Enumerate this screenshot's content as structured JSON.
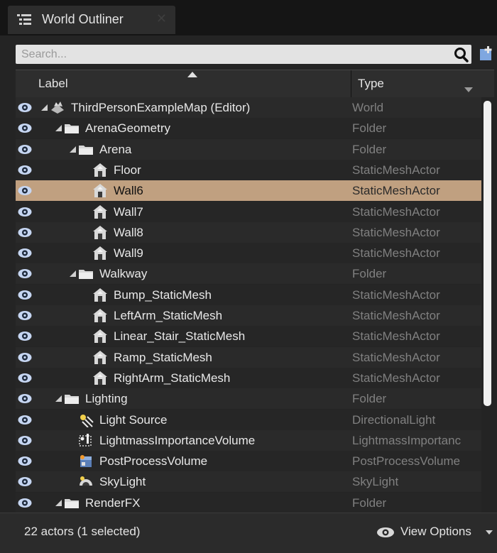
{
  "tab": {
    "title": "World Outliner",
    "icon": "list-icon",
    "close_icon": "close-icon"
  },
  "search": {
    "value": "",
    "placeholder": "Search..."
  },
  "columns": {
    "label": "Label",
    "type": "Type"
  },
  "rows": [
    {
      "label": "ThirdPersonExampleMap (Editor)",
      "type": "World",
      "icon": "world-icon",
      "depth": 0,
      "expanded": true,
      "selected": false
    },
    {
      "label": "ArenaGeometry",
      "type": "Folder",
      "icon": "folder-icon",
      "depth": 1,
      "expanded": true,
      "selected": false
    },
    {
      "label": "Arena",
      "type": "Folder",
      "icon": "folder-icon",
      "depth": 2,
      "expanded": true,
      "selected": false
    },
    {
      "label": "Floor",
      "type": "StaticMeshActor",
      "icon": "static-mesh-icon",
      "depth": 3,
      "expanded": null,
      "selected": false
    },
    {
      "label": "Wall6",
      "type": "StaticMeshActor",
      "icon": "static-mesh-icon",
      "depth": 3,
      "expanded": null,
      "selected": true
    },
    {
      "label": "Wall7",
      "type": "StaticMeshActor",
      "icon": "static-mesh-icon",
      "depth": 3,
      "expanded": null,
      "selected": false
    },
    {
      "label": "Wall8",
      "type": "StaticMeshActor",
      "icon": "static-mesh-icon",
      "depth": 3,
      "expanded": null,
      "selected": false
    },
    {
      "label": "Wall9",
      "type": "StaticMeshActor",
      "icon": "static-mesh-icon",
      "depth": 3,
      "expanded": null,
      "selected": false
    },
    {
      "label": "Walkway",
      "type": "Folder",
      "icon": "folder-icon",
      "depth": 2,
      "expanded": true,
      "selected": false
    },
    {
      "label": "Bump_StaticMesh",
      "type": "StaticMeshActor",
      "icon": "static-mesh-icon",
      "depth": 3,
      "expanded": null,
      "selected": false
    },
    {
      "label": "LeftArm_StaticMesh",
      "type": "StaticMeshActor",
      "icon": "static-mesh-icon",
      "depth": 3,
      "expanded": null,
      "selected": false
    },
    {
      "label": "Linear_Stair_StaticMesh",
      "type": "StaticMeshActor",
      "icon": "static-mesh-icon",
      "depth": 3,
      "expanded": null,
      "selected": false
    },
    {
      "label": "Ramp_StaticMesh",
      "type": "StaticMeshActor",
      "icon": "static-mesh-icon",
      "depth": 3,
      "expanded": null,
      "selected": false
    },
    {
      "label": "RightArm_StaticMesh",
      "type": "StaticMeshActor",
      "icon": "static-mesh-icon",
      "depth": 3,
      "expanded": null,
      "selected": false
    },
    {
      "label": "Lighting",
      "type": "Folder",
      "icon": "folder-icon",
      "depth": 1,
      "expanded": true,
      "selected": false
    },
    {
      "label": "Light Source",
      "type": "DirectionalLight",
      "icon": "directional-light-icon",
      "depth": 2,
      "expanded": null,
      "selected": false
    },
    {
      "label": "LightmassImportanceVolume",
      "type": "LightmassImportanc",
      "icon": "lightmass-volume-icon",
      "depth": 2,
      "expanded": null,
      "selected": false
    },
    {
      "label": "PostProcessVolume",
      "type": "PostProcessVolume",
      "icon": "post-process-volume-icon",
      "depth": 2,
      "expanded": null,
      "selected": false
    },
    {
      "label": "SkyLight",
      "type": "SkyLight",
      "icon": "sky-light-icon",
      "depth": 2,
      "expanded": null,
      "selected": false
    },
    {
      "label": "RenderFX",
      "type": "Folder",
      "icon": "folder-icon",
      "depth": 1,
      "expanded": true,
      "selected": false
    }
  ],
  "footer": {
    "actor_count": "22 actors (1 selected)",
    "view_options": "View Options"
  },
  "colors": {
    "selected_row": "#c0a080",
    "type_text": "#808080",
    "eye": "#c6d6f2"
  }
}
